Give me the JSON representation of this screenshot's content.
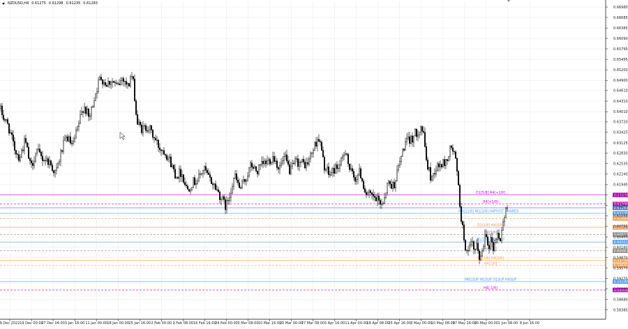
{
  "symbol_info": {
    "symbol": "NZDUSD,H4",
    "open": "0.61275",
    "high": "0.61298",
    "low": "0.61235",
    "close": "0.61283"
  },
  "colors": {
    "candle": "#000000",
    "grid": "#e8e8e8",
    "axis_text": "#202020",
    "current_price_tag": "#3b6fc8",
    "magenta": "#d400d4",
    "blue": "#4f9ef0",
    "orange": "#f0a050",
    "gray": "#8c8c8c",
    "olive": "#556b2f"
  },
  "chart_data": {
    "type": "candlestick",
    "title": "",
    "xlabel": "",
    "ylabel": "",
    "ylim": [
      0.5812,
      0.6712
    ],
    "grid": true,
    "x_ticks": [
      "9 Dec 2022",
      "19 Dec 00:00",
      "27 Dec 04:00",
      "3 Jan 16:00",
      "11 Jan 00:00",
      "18 Jan 00:00",
      "25 Jan 16:00",
      "2 Feb 00:00",
      "9 Feb 08:00",
      "16 Feb 16:00",
      "24 Feb 00:00",
      "3 Mar 08:00",
      "10 Mar 16:00",
      "20 Mar 00:00",
      "27 Mar 08:00",
      "3 Apr 16:00",
      "11 Apr 00:00",
      "18 Apr 08:00",
      "25 Apr 16:00",
      "3 May 00:00",
      "10 May 08:00",
      "17 May 16:00",
      "25 May 00:00",
      "1 Jun 08:00",
      "8 Jun 16:00"
    ],
    "y_ticks": [
      "0.66980",
      "0.66685",
      "0.66385",
      "0.66090",
      "0.65795",
      "0.65495",
      "0.65200",
      "0.64900",
      "0.64610",
      "0.64310",
      "0.64010",
      "0.63720",
      "0.63425",
      "0.63125",
      "0.62830",
      "0.62535",
      "0.62240",
      "0.61940",
      "0.61645",
      "0.61350",
      "0.61050",
      "0.60755",
      "0.60455",
      "0.60160",
      "0.59870",
      "0.59570",
      "0.59275",
      "0.58980",
      "0.58680",
      "0.58385"
    ],
    "anchor_closes": [
      [
        0,
        0.641
      ],
      [
        5,
        0.6385
      ],
      [
        12,
        0.636
      ],
      [
        20,
        0.63
      ],
      [
        28,
        0.627
      ],
      [
        36,
        0.632
      ],
      [
        44,
        0.624
      ],
      [
        52,
        0.629
      ],
      [
        60,
        0.627
      ],
      [
        70,
        0.626
      ],
      [
        80,
        0.6225
      ],
      [
        88,
        0.629
      ],
      [
        96,
        0.633
      ],
      [
        104,
        0.63
      ],
      [
        112,
        0.636
      ],
      [
        120,
        0.642
      ],
      [
        128,
        0.638
      ],
      [
        136,
        0.645
      ],
      [
        144,
        0.65
      ],
      [
        152,
        0.648
      ],
      [
        160,
        0.649
      ],
      [
        168,
        0.647
      ],
      [
        176,
        0.65
      ],
      [
        184,
        0.647
      ],
      [
        188,
        0.651
      ],
      [
        192,
        0.647
      ],
      [
        196,
        0.637
      ],
      [
        204,
        0.635
      ],
      [
        212,
        0.636
      ],
      [
        220,
        0.633
      ],
      [
        228,
        0.63
      ],
      [
        236,
        0.629
      ],
      [
        244,
        0.626
      ],
      [
        252,
        0.622
      ],
      [
        260,
        0.623
      ],
      [
        268,
        0.618
      ],
      [
        276,
        0.62
      ],
      [
        284,
        0.621
      ],
      [
        292,
        0.624
      ],
      [
        300,
        0.621
      ],
      [
        308,
        0.619
      ],
      [
        316,
        0.616
      ],
      [
        320,
        0.6145
      ],
      [
        324,
        0.613
      ],
      [
        328,
        0.616
      ],
      [
        336,
        0.622
      ],
      [
        344,
        0.618
      ],
      [
        352,
        0.621
      ],
      [
        360,
        0.625
      ],
      [
        368,
        0.623
      ],
      [
        376,
        0.625
      ],
      [
        384,
        0.626
      ],
      [
        392,
        0.6275
      ],
      [
        400,
        0.624
      ],
      [
        408,
        0.627
      ],
      [
        416,
        0.623
      ],
      [
        424,
        0.626
      ],
      [
        432,
        0.6255
      ],
      [
        440,
        0.625
      ],
      [
        448,
        0.629
      ],
      [
        456,
        0.633
      ],
      [
        460,
        0.63
      ],
      [
        464,
        0.625
      ],
      [
        472,
        0.622
      ],
      [
        480,
        0.624
      ],
      [
        488,
        0.625
      ],
      [
        496,
        0.63
      ],
      [
        500,
        0.624
      ],
      [
        508,
        0.621
      ],
      [
        516,
        0.623
      ],
      [
        524,
        0.617
      ],
      [
        532,
        0.616
      ],
      [
        540,
        0.615
      ],
      [
        548,
        0.614
      ],
      [
        556,
        0.62
      ],
      [
        564,
        0.619
      ],
      [
        572,
        0.625
      ],
      [
        580,
        0.631
      ],
      [
        588,
        0.632
      ],
      [
        596,
        0.634
      ],
      [
        604,
        0.636
      ],
      [
        608,
        0.632
      ],
      [
        612,
        0.625
      ],
      [
        618,
        0.621
      ],
      [
        624,
        0.624
      ],
      [
        632,
        0.625
      ],
      [
        640,
        0.626
      ],
      [
        646,
        0.63
      ],
      [
        650,
        0.629
      ],
      [
        654,
        0.625
      ],
      [
        658,
        0.616
      ],
      [
        662,
        0.608
      ],
      [
        666,
        0.603
      ],
      [
        670,
        0.599
      ],
      [
        676,
        0.603
      ],
      [
        680,
        0.6
      ],
      [
        684,
        0.602
      ],
      [
        688,
        0.598
      ],
      [
        692,
        0.601
      ],
      [
        696,
        0.607
      ],
      [
        700,
        0.602
      ],
      [
        704,
        0.604
      ],
      [
        708,
        0.601
      ],
      [
        712,
        0.606
      ],
      [
        716,
        0.603
      ],
      [
        720,
        0.608
      ],
      [
        724,
        0.611
      ],
      [
        727,
        0.6128
      ]
    ],
    "levels": [
      {
        "price": 0.61648,
        "label": "D1[5/8] H4[+2/8]",
        "tag": "0.61648",
        "color": "magenta",
        "dash": false,
        "label_x": 703
      },
      {
        "price": 0.6139,
        "label": "H4[+1/8]",
        "tag": "0.61390",
        "color": "magenta",
        "dash": true,
        "label_x": 703
      },
      {
        "price": 0.61283,
        "label": "",
        "tag": "0.61283",
        "color": "current_price_tag",
        "dash": false,
        "label_x": 0
      },
      {
        "price": 0.61125,
        "label": "MN1[1/8] W1[3/8] H4PIVOT SHARES",
        "tag": "0.61125",
        "color": "blue",
        "dash": false,
        "label_x": 700
      },
      {
        "price": 0.6098,
        "label": "",
        "tag": "0.60980",
        "color": "orange",
        "dash": true,
        "label_x": 0
      },
      {
        "price": 0.60727,
        "label": "D1[3/8] H4[6/8]",
        "tag": "0.60727",
        "color": "orange",
        "dash": false,
        "label_x": 703
      },
      {
        "price": 0.60523,
        "label": "H4[5/8]",
        "tag": "0.60523",
        "color": "gray",
        "dash": true,
        "label_x": 703
      },
      {
        "price": 0.60311,
        "label": "D1[2/8] H4PIVOT",
        "tag": "0.60311",
        "color": "blue",
        "dash": false,
        "label_x": 703
      },
      {
        "price": 0.60063,
        "label": "H4[3/8]",
        "tag": "0.60063",
        "color": "gray",
        "dash": true,
        "label_x": 703
      },
      {
        "price": 0.5979,
        "label": "D1[1/8] H4[2/8]",
        "tag": "0.59790",
        "color": "orange",
        "dash": false,
        "label_x": 703
      },
      {
        "price": 0.59645,
        "label": "H4[1/8]",
        "tag": "0.59645",
        "color": "orange",
        "dash": true,
        "label_x": 703
      },
      {
        "price": 0.5919,
        "label": "MN1SUP W1SUP D1SUP H4SUP",
        "tag": "0.59190",
        "color": "blue",
        "dash": false,
        "label_x": 703
      },
      {
        "price": 0.5895,
        "label": "H4[-1/8]",
        "tag": "0.58950",
        "color": "magenta",
        "dash": true,
        "label_x": 703
      }
    ]
  }
}
